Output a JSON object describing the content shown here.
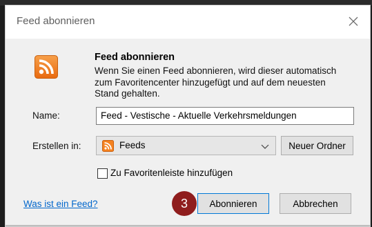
{
  "dialog": {
    "title": "Feed abonnieren",
    "heading": "Feed abonnieren",
    "description": "Wenn Sie einen Feed abonnieren, wird dieser automatisch zum Favoritencenter hinzugefügt und auf dem neuesten Stand gehalten.",
    "name_label": "Name:",
    "name_value": "Feed - Vestische - Aktuelle Verkehrsmeldungen",
    "create_in_label": "Erstellen in:",
    "create_in_value": "Feeds",
    "new_folder_button": "Neuer Ordner",
    "favorites_bar_checkbox": "Zu Favoritenleiste hinzufügen",
    "favorites_bar_checked": false,
    "help_link": "Was ist ein Feed?",
    "subscribe_button": "Abonnieren",
    "cancel_button": "Abbrechen",
    "step_marker": "3"
  },
  "icons": {
    "feed": "rss-feed-icon",
    "close": "close-icon",
    "dropdown": "chevron-down-icon"
  },
  "colors": {
    "rss_orange": "#f58220",
    "link_blue": "#0066cc",
    "step_marker": "#8f1d1d"
  }
}
